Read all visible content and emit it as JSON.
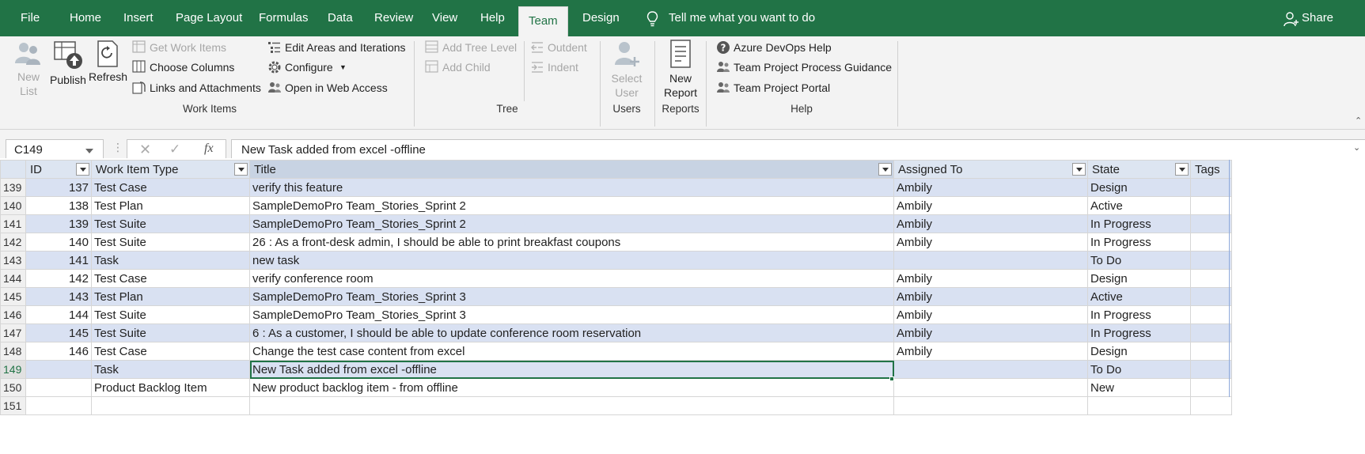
{
  "menu": {
    "tabs": [
      "File",
      "Home",
      "Insert",
      "Page Layout",
      "Formulas",
      "Data",
      "Review",
      "View",
      "Help",
      "Team",
      "Design"
    ],
    "active_tab": "Team",
    "tell_me": "Tell me what you want to do",
    "share": "Share"
  },
  "ribbon": {
    "work_items": {
      "group_label": "Work Items",
      "new_list": "New\nList",
      "publish": "Publish",
      "refresh": "Refresh",
      "get_work_items": "Get Work Items",
      "choose_columns": "Choose Columns",
      "links_and_attachments": "Links and Attachments",
      "edit_areas": "Edit Areas and Iterations",
      "configure": "Configure",
      "open_web": "Open in Web Access"
    },
    "tree": {
      "group_label": "Tree",
      "add_tree_level": "Add Tree Level",
      "add_child": "Add Child",
      "outdent": "Outdent",
      "indent": "Indent"
    },
    "users": {
      "group_label": "Users",
      "select_user": "Select\nUser"
    },
    "reports": {
      "group_label": "Reports",
      "new_report": "New\nReport"
    },
    "help": {
      "group_label": "Help",
      "azure_help": "Azure DevOps Help",
      "process_guidance": "Team Project Process Guidance",
      "portal": "Team Project Portal"
    }
  },
  "formula_bar": {
    "name_box": "C149",
    "formula": "New Task added from excel -offline"
  },
  "sheet": {
    "columns": [
      "ID",
      "Work Item Type",
      "Title",
      "Assigned To",
      "State",
      "Tags"
    ],
    "rows": [
      {
        "rn": "139",
        "id": "137",
        "type": "Test Case",
        "title": "verify this feature",
        "assigned": "Ambily",
        "state": "Design"
      },
      {
        "rn": "140",
        "id": "138",
        "type": "Test Plan",
        "title": "SampleDemoPro Team_Stories_Sprint 2",
        "assigned": "Ambily",
        "state": "Active"
      },
      {
        "rn": "141",
        "id": "139",
        "type": "Test Suite",
        "title": "SampleDemoPro Team_Stories_Sprint 2",
        "assigned": "Ambily",
        "state": "In Progress"
      },
      {
        "rn": "142",
        "id": "140",
        "type": "Test Suite",
        "title": "26 : As a front-desk admin, I should be able to print breakfast coupons",
        "assigned": "Ambily",
        "state": "In Progress"
      },
      {
        "rn": "143",
        "id": "141",
        "type": "Task",
        "title": "new task",
        "assigned": "",
        "state": "To Do"
      },
      {
        "rn": "144",
        "id": "142",
        "type": "Test Case",
        "title": "verify conference room",
        "assigned": "Ambily",
        "state": "Design"
      },
      {
        "rn": "145",
        "id": "143",
        "type": "Test Plan",
        "title": "SampleDemoPro Team_Stories_Sprint 3",
        "assigned": "Ambily",
        "state": "Active"
      },
      {
        "rn": "146",
        "id": "144",
        "type": "Test Suite",
        "title": "SampleDemoPro Team_Stories_Sprint 3",
        "assigned": "Ambily",
        "state": "In Progress"
      },
      {
        "rn": "147",
        "id": "145",
        "type": "Test Suite",
        "title": "6 : As a customer, I should be able to update conference room reservation",
        "assigned": "Ambily",
        "state": "In Progress"
      },
      {
        "rn": "148",
        "id": "146",
        "type": "Test Case",
        "title": "Change the test case content from excel",
        "assigned": "Ambily",
        "state": "Design"
      },
      {
        "rn": "149",
        "id": "",
        "type": "Task",
        "title": "New Task added from excel -offline",
        "assigned": "",
        "state": "To Do"
      },
      {
        "rn": "150",
        "id": "",
        "type": "Product Backlog Item",
        "title": "New product backlog item - from offline",
        "assigned": "",
        "state": "New"
      },
      {
        "rn": "151",
        "id": "",
        "type": "",
        "title": "",
        "assigned": "",
        "state": ""
      }
    ]
  },
  "colors": {
    "excel_green": "#217346",
    "band_blue": "#d9e1f2",
    "header_blue": "#dde5f1"
  },
  "icons": [
    "lightbulb-icon",
    "share-person-icon",
    "new-list-icon",
    "publish-icon",
    "refresh-icon",
    "select-user-icon",
    "new-report-icon",
    "help-circle-icon",
    "guidance-icon",
    "portal-icon"
  ]
}
